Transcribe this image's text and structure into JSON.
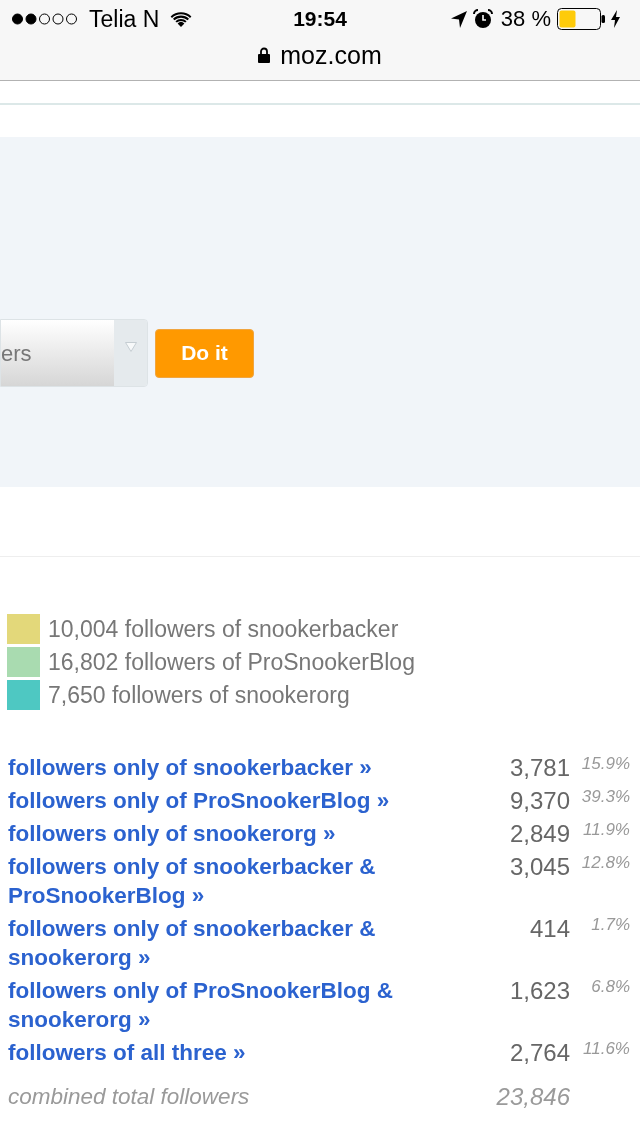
{
  "status_bar": {
    "carrier": "Telia N",
    "time": "19:54",
    "battery": "38 %"
  },
  "address_bar": {
    "url": "moz.com"
  },
  "form": {
    "select": {
      "value": "ers"
    },
    "submit": "Do it"
  },
  "legend": [
    {
      "label": "10,004 followers of snookerbacker",
      "color": "#e3d87a"
    },
    {
      "label": "16,802 followers of ProSnookerBlog",
      "color": "#a9dbb0"
    },
    {
      "label": "7,650 followers of snookerorg",
      "color": "#4ec8c2"
    }
  ],
  "segments": [
    {
      "label": "followers only of snookerbacker »",
      "count": "3,781",
      "share": "15.9%"
    },
    {
      "label": "followers only of ProSnookerBlog »",
      "count": "9,370",
      "share": "39.3%"
    },
    {
      "label": "followers only of snookerorg »",
      "count": "2,849",
      "share": "11.9%"
    },
    {
      "label": "followers only of snookerbacker & ProSnookerBlog »",
      "count": "3,045",
      "share": "12.8%"
    },
    {
      "label": "followers only of snookerbacker & snookerorg »",
      "count": "414",
      "share": "1.7%"
    },
    {
      "label": "followers only of ProSnookerBlog & snookerorg »",
      "count": "1,623",
      "share": "6.8%"
    },
    {
      "label": "followers of all three »",
      "count": "2,764",
      "share": "11.6%"
    }
  ],
  "total": {
    "label": "combined total followers",
    "count": "23,846"
  }
}
